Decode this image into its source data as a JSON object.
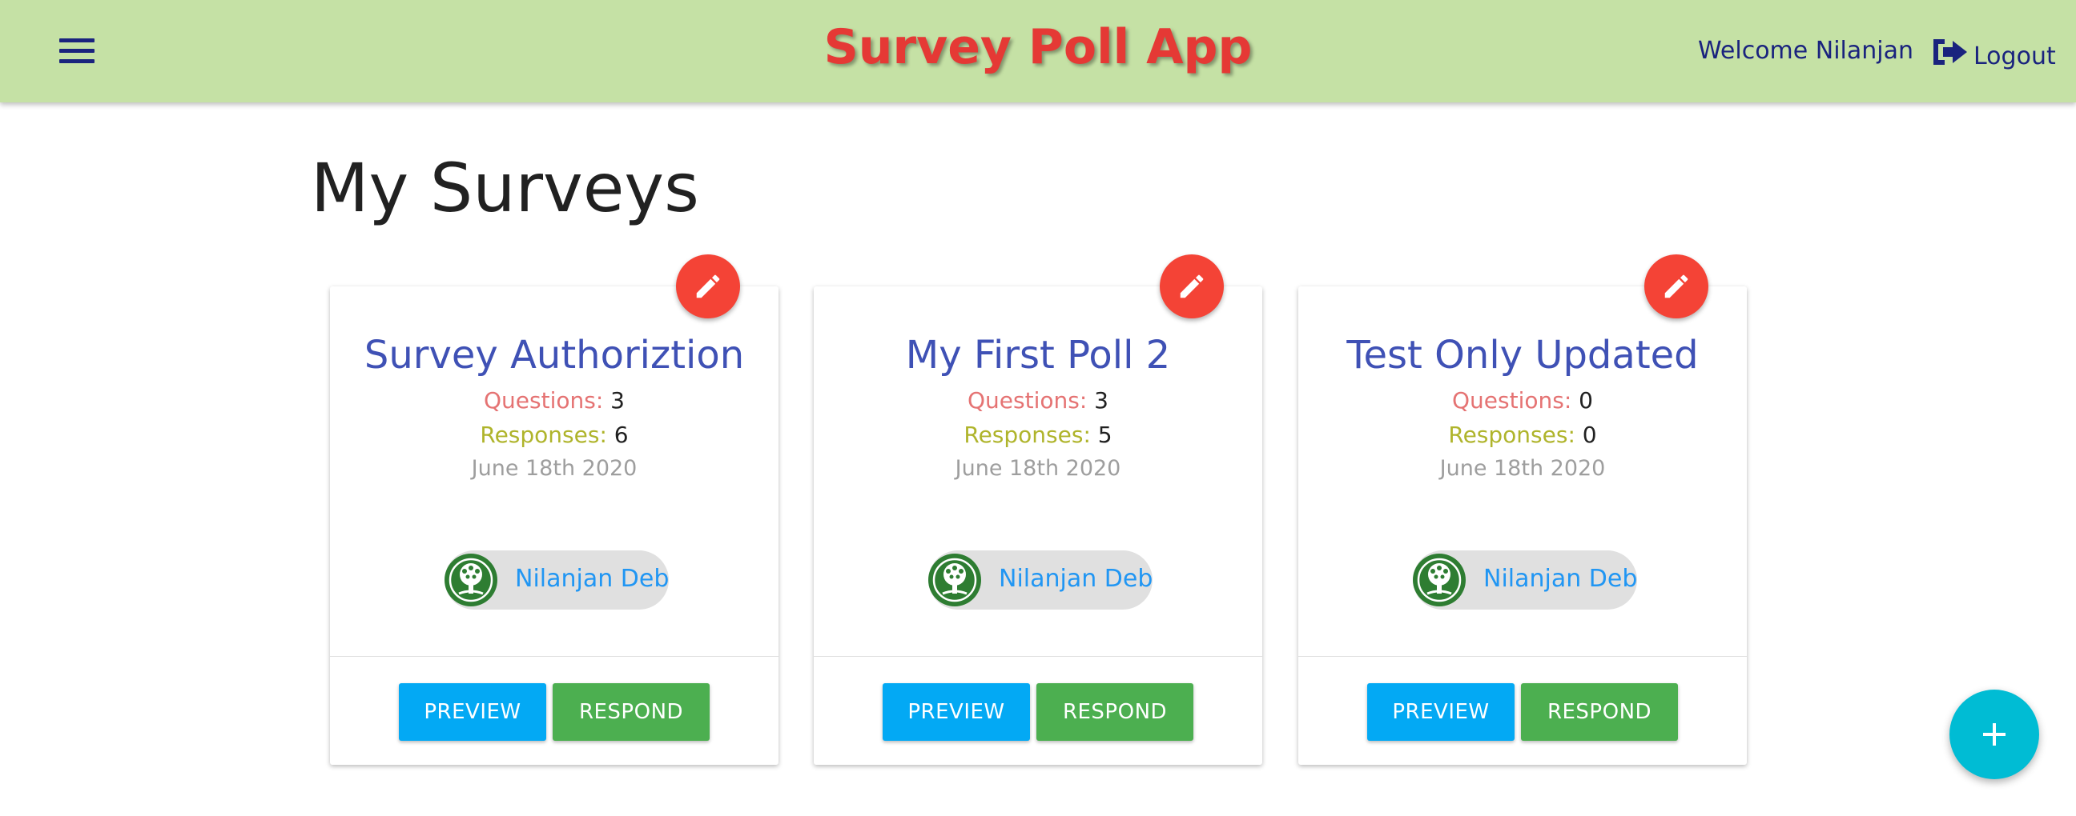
{
  "header": {
    "app_title": "Survey Poll App",
    "welcome_text": "Welcome Nilanjan",
    "logout_label": "Logout",
    "menu_icon": "hamburger-menu-icon",
    "logout_icon": "sign-out-icon",
    "background_color": "#c5e1a5",
    "title_color": "#e53935"
  },
  "main": {
    "page_title": "My Surveys"
  },
  "surveys": [
    {
      "title": "Survey Authoriztion",
      "questions_label": "Questions:",
      "questions": "3",
      "responses_label": "Responses:",
      "responses": "6",
      "date": "June 18th 2020",
      "author": "Nilanjan Deb",
      "preview_label": "PREVIEW",
      "respond_label": "RESPOND"
    },
    {
      "title": "My First Poll 2",
      "questions_label": "Questions:",
      "questions": "3",
      "responses_label": "Responses:",
      "responses": "5",
      "date": "June 18th 2020",
      "author": "Nilanjan Deb",
      "preview_label": "PREVIEW",
      "respond_label": "RESPOND"
    },
    {
      "title": "Test Only Updated",
      "questions_label": "Questions:",
      "questions": "0",
      "responses_label": "Responses:",
      "responses": "0",
      "date": "June 18th 2020",
      "author": "Nilanjan Deb",
      "preview_label": "PREVIEW",
      "respond_label": "RESPOND"
    }
  ],
  "colors": {
    "edit_fab": "#f44336",
    "preview_button": "#03a9f4",
    "respond_button": "#4caf50",
    "add_fab": "#00bcd4",
    "card_title": "#3f51b5"
  },
  "icons": {
    "edit": "pencil-icon",
    "add": "plus-icon",
    "avatar": "tree-avatar-icon"
  }
}
